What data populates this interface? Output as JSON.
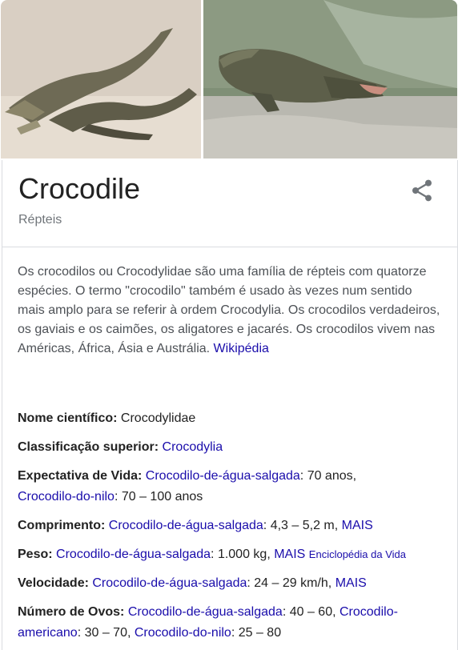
{
  "images": [
    {
      "name": "crocodile-photo-1",
      "alt": ""
    },
    {
      "name": "crocodile-photo-2",
      "alt": ""
    }
  ],
  "header": {
    "title": "Crocodile",
    "subtitle": "Répteis",
    "share_icon": "share-icon"
  },
  "description": {
    "text": "Os crocodilos ou Crocodylidae são uma família de répteis com quatorze espécies. O termo \"crocodilo\" também é usado às vezes num sentido mais amplo para se referir à ordem Crocodylia. Os crocodilos verdadeiros, os gaviais e os caimões, os aligatores e jacarés. Os crocodilos vivem nas Américas, África, Ásia e Austrália.",
    "source_link": "Wikipédia"
  },
  "facts": {
    "scientific_name": {
      "label": "Nome científico:",
      "value": "Crocodylidae"
    },
    "superior_classification": {
      "label": "Classificação superior:",
      "link": "Crocodylia"
    },
    "life_expectancy": {
      "label": "Expectativa de Vida:",
      "link1": "Crocodilo-de-água-salgada",
      "value1": ": 70 anos,",
      "link2": "Crocodilo-do-nilo",
      "value2": ": 70 – 100 anos"
    },
    "length": {
      "label": "Comprimento:",
      "link1": "Crocodilo-de-água-salgada",
      "value1": ": 4,3 – 5,2 m,",
      "more": "MAIS"
    },
    "weight": {
      "label": "Peso:",
      "link1": "Crocodilo-de-água-salgada",
      "value1": ": 1.000 kg,",
      "more": "MAIS",
      "source": "Enciclopédia da Vida"
    },
    "speed": {
      "label": "Velocidade:",
      "link1": "Crocodilo-de-água-salgada",
      "value1": ": 24 – 29 km/h,",
      "more": "MAIS"
    },
    "eggs": {
      "label": "Número de Ovos:",
      "link1": "Crocodilo-de-água-salgada",
      "value1": ": 40 – 60,",
      "link2": "Crocodilo-americano",
      "value2": ": 30 – 70,",
      "link3": "Crocodilo-do-nilo",
      "value3": ": 25 – 80"
    }
  },
  "colors": {
    "link": "#1a0dab",
    "text": "#222222",
    "muted": "#70757a",
    "border": "#dadce0"
  }
}
